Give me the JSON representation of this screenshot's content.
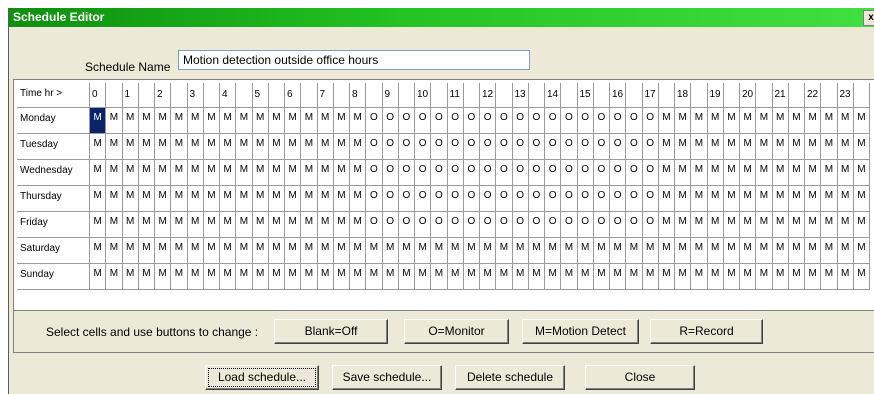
{
  "window": {
    "title": "Schedule Editor",
    "close_glyph": "x"
  },
  "schedule": {
    "name_label": "Schedule Name",
    "name_value": "Motion detection outside office hours"
  },
  "grid": {
    "corner_label": "Time hr >",
    "hours": [
      "0",
      "1",
      "2",
      "3",
      "4",
      "5",
      "6",
      "7",
      "8",
      "9",
      "10",
      "11",
      "12",
      "13",
      "14",
      "15",
      "16",
      "17",
      "18",
      "19",
      "20",
      "21",
      "22",
      "23"
    ],
    "days": [
      {
        "name": "Monday",
        "cells": "MMMMMMMMMMMMMMMMMOOOOOOOOOOOOOOOOOOMMMMMMMMMMMMM"
      },
      {
        "name": "Tuesday",
        "cells": "MMMMMMMMMMMMMMMMMOOOOOOOOOOOOOOOOOOMMMMMMMMMMMMM"
      },
      {
        "name": "Wednesday",
        "cells": "MMMMMMMMMMMMMMMMMOOOOOOOOOOOOOOOOOOMMMMMMMMMMMMM"
      },
      {
        "name": "Thursday",
        "cells": "MMMMMMMMMMMMMMMMMOOOOOOOOOOOOOOOOOOMMMMMMMMMMMMM"
      },
      {
        "name": "Friday",
        "cells": "MMMMMMMMMMMMMMMMMOOOOOOOOOOOOOOOOOOMMMMMMMMMMMMM"
      },
      {
        "name": "Saturday",
        "cells": "MMMMMMMMMMMMMMMMMMMMMMMMMMMMMMMMMMMMMMMMMMMMMMMM"
      },
      {
        "name": "Sunday",
        "cells": "MMMMMMMMMMMMMMMMMMMMMMMMMMMMMMMMMMMMMMMMMMMMMMMM"
      }
    ]
  },
  "controls": {
    "hint": "Select cells and use buttons to change :",
    "blank_label": "Blank=Off",
    "monitor_label": "O=Monitor",
    "motion_label": "M=Motion Detect",
    "record_label": "R=Record"
  },
  "footer": {
    "load_label": "Load schedule...",
    "save_label": "Save schedule...",
    "delete_label": "Delete schedule",
    "close_label": "Close"
  }
}
